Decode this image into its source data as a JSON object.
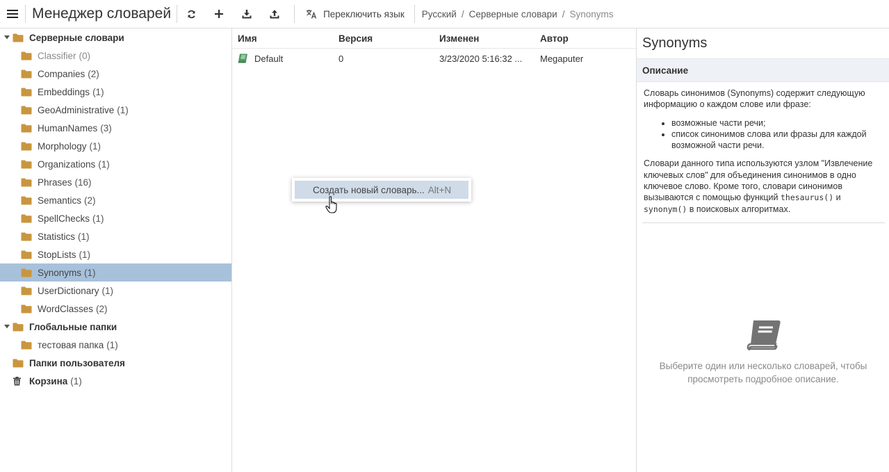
{
  "app": {
    "title": "Менеджер словарей"
  },
  "toolbar": {
    "menu_icon": "hamburger-icon",
    "refresh_icon": "refresh-icon",
    "add_icon": "plus-icon",
    "import_icon": "download-icon",
    "export_icon": "upload-icon",
    "lang_icon": "translate-icon",
    "switch_language": "Переключить язык"
  },
  "breadcrumb": [
    "Русский",
    "Серверные словари",
    "Synonyms"
  ],
  "tree": {
    "server": {
      "label": "Серверные словари"
    },
    "server_children": [
      {
        "label": "Classifier",
        "count": "(0)"
      },
      {
        "label": "Companies",
        "count": "(2)"
      },
      {
        "label": "Embeddings",
        "count": "(1)"
      },
      {
        "label": "GeoAdministrative",
        "count": "(1)"
      },
      {
        "label": "HumanNames",
        "count": "(3)"
      },
      {
        "label": "Morphology",
        "count": "(1)"
      },
      {
        "label": "Organizations",
        "count": "(1)"
      },
      {
        "label": "Phrases",
        "count": "(16)"
      },
      {
        "label": "Semantics",
        "count": "(2)"
      },
      {
        "label": "SpellChecks",
        "count": "(1)"
      },
      {
        "label": "Statistics",
        "count": "(1)"
      },
      {
        "label": "StopLists",
        "count": "(1)"
      },
      {
        "label": "Synonyms",
        "count": "(1)"
      },
      {
        "label": "UserDictionary",
        "count": "(1)"
      },
      {
        "label": "WordClasses",
        "count": "(2)"
      }
    ],
    "global": {
      "label": "Глобальные папки"
    },
    "global_children": [
      {
        "label": "тестовая папка",
        "count": "(1)"
      }
    ],
    "user": {
      "label": "Папки пользователя"
    },
    "trash": {
      "label": "Корзина",
      "count": "(1)"
    }
  },
  "list": {
    "columns": [
      "Имя",
      "Версия",
      "Изменен",
      "Автор"
    ],
    "rows": [
      {
        "name": "Default",
        "version": "0",
        "modified": "3/23/2020 5:16:32 ...",
        "author": "Megaputer"
      }
    ]
  },
  "context_menu": {
    "item": "Создать новый словарь...",
    "shortcut": "Alt+N"
  },
  "details": {
    "title": "Synonyms",
    "section": "Описание",
    "intro": "Словарь синонимов (Synonyms) содержит следующую информацию о каждом слове или фразе:",
    "bullets": [
      "возможные части речи;",
      "список синонимов слова или фразы для каждой возможной части речи."
    ],
    "para_a": "Словари данного типа используются узлом \"Извлечение ключевых слов\" для объединения синонимов в одно ключевое слово. Кроме того, словари синонимов вызываются с помощью функций ",
    "code1": "thesaurus()",
    "para_b": " и ",
    "code2": "synonym()",
    "para_c": " в поисковых алгоритмах.",
    "empty_text": "Выберите один или несколько словарей, чтобы просмотреть подробное описание."
  },
  "colors": {
    "folder": "#c9963f",
    "selected_row": "#a8c1db",
    "menu_highlight": "#cfdbe8",
    "dictionary_icon": "#4c9a60"
  }
}
